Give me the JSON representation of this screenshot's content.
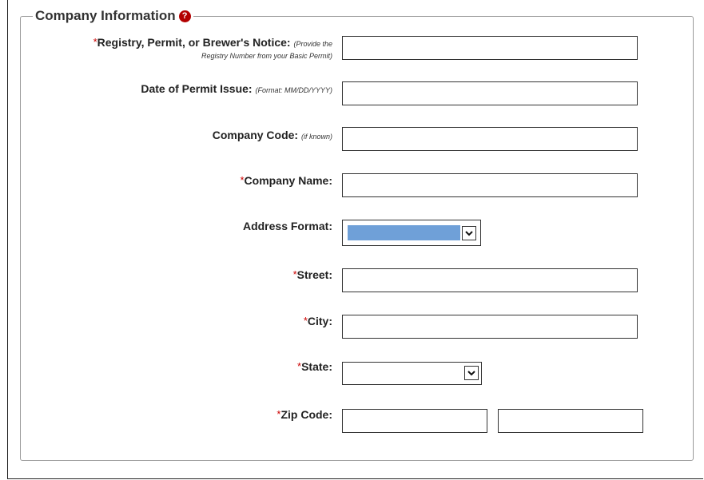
{
  "section": {
    "title": "Company Information",
    "help_icon": "question-circle-icon"
  },
  "fields": {
    "registry": {
      "required_mark": "*",
      "label": "Registry, Permit, or Brewer's Notice:",
      "hint1": "(Provide the",
      "hint2": "Registry Number from your Basic Permit)",
      "value": ""
    },
    "permit_date": {
      "label": "Date of Permit Issue:",
      "hint": "(Format: MM/DD/YYYY)",
      "value": ""
    },
    "company_code": {
      "label": "Company Code:",
      "hint": "(if known)",
      "value": ""
    },
    "company_name": {
      "required_mark": "*",
      "label": "Company Name:",
      "value": ""
    },
    "address_format": {
      "label": "Address Format:",
      "selected_value": "",
      "arrow_icon": "chevron-down-icon"
    },
    "street": {
      "required_mark": "*",
      "label": "Street:",
      "value": ""
    },
    "city": {
      "required_mark": "*",
      "label": "City:",
      "value": ""
    },
    "state": {
      "required_mark": "*",
      "label": "State:",
      "selected_value": "",
      "arrow_icon": "chevron-down-icon"
    },
    "zip": {
      "required_mark": "*",
      "label": "Zip Code:",
      "value": "",
      "extension_value": ""
    }
  },
  "colors": {
    "required": "#cc0000",
    "help_icon": "#b30000",
    "select_highlight": "#6fa0d8"
  }
}
